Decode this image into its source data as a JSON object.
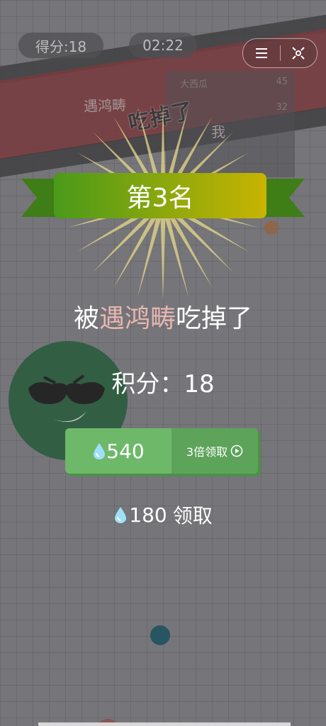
{
  "hud": {
    "score_label": "得分:18",
    "timer": "02:22"
  },
  "capsule": {
    "menu_icon": "menu-icon",
    "close_icon": "close-target-icon"
  },
  "leaderboard": {
    "rows": [
      {
        "name": "大西瓜",
        "value": "45"
      },
      {
        "name": "",
        "value": "32"
      }
    ]
  },
  "kill_feed": {
    "killer": "遇鸿畴",
    "action": "吃掉了",
    "victim": "我"
  },
  "result": {
    "rank_label": "第3名",
    "message_prefix": "被",
    "killer_name": "遇鸿畴",
    "message_suffix": "吃掉了",
    "points_label": "积分：",
    "points_value": "18"
  },
  "rewards": {
    "triple_amount": "540",
    "triple_label": "3倍领取",
    "plain_amount": "180",
    "plain_label": "领取"
  },
  "colors": {
    "ribbon_green": "#4a9a1a",
    "ribbon_yellow": "#c8b400",
    "button_green": "#6eb86a",
    "killer_name": "#e8b7b0"
  }
}
